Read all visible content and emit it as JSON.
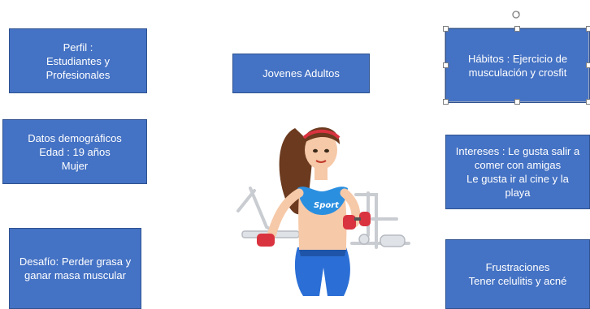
{
  "boxes": {
    "perfil": {
      "lines": [
        "Perfil :",
        "Estudiantes y",
        "Profesionales"
      ]
    },
    "jovenes": {
      "lines": [
        "Jovenes Adultos"
      ]
    },
    "habitos": {
      "lines": [
        "Hábitos : Ejercicio de",
        "musculación y crosfit"
      ]
    },
    "datos": {
      "lines": [
        "Datos demográficos",
        "Edad : 19 años",
        "Mujer"
      ]
    },
    "intereses": {
      "lines": [
        "Intereses : Le gusta salir a",
        "comer con amigas",
        "Le gusta ir al cine y la",
        "playa"
      ]
    },
    "desafio": {
      "lines": [
        "Desafío: Perder grasa y",
        "ganar masa muscular"
      ]
    },
    "frustraciones": {
      "lines": [
        "Frustraciones",
        "Tener celulitis y acné"
      ]
    }
  },
  "illustration": {
    "shirt_text": "Sport",
    "icon": "fitness-woman-illustration"
  },
  "colors": {
    "box_fill": "#4472c4",
    "box_border": "#2f528f",
    "box_text": "#ffffff"
  }
}
